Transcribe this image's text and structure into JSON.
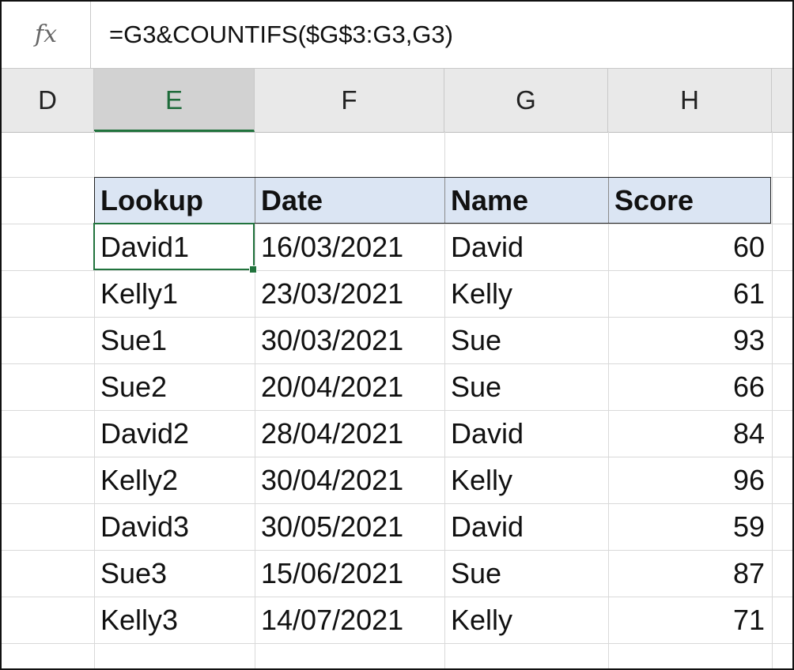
{
  "formula_bar": {
    "fx_label": "fx",
    "formula": "=G3&COUNTIFS($G$3:G3,G3)"
  },
  "columns": [
    "D",
    "E",
    "F",
    "G",
    "H"
  ],
  "selected_column": "E",
  "table": {
    "headers": [
      "Lookup",
      "Date",
      "Name",
      "Score"
    ],
    "rows": [
      [
        "David1",
        "16/03/2021",
        "David",
        "60"
      ],
      [
        "Kelly1",
        "23/03/2021",
        "Kelly",
        "61"
      ],
      [
        "Sue1",
        "30/03/2021",
        "Sue",
        "93"
      ],
      [
        "Sue2",
        "20/04/2021",
        "Sue",
        "66"
      ],
      [
        "David2",
        "28/04/2021",
        "David",
        "84"
      ],
      [
        "Kelly2",
        "30/04/2021",
        "Kelly",
        "96"
      ],
      [
        "David3",
        "30/05/2021",
        "David",
        "59"
      ],
      [
        "Sue3",
        "15/06/2021",
        "Sue",
        "87"
      ],
      [
        "Kelly3",
        "14/07/2021",
        "Kelly",
        "71"
      ]
    ]
  },
  "colors": {
    "selection": "#21733d",
    "header_fill": "#dbe5f3"
  }
}
